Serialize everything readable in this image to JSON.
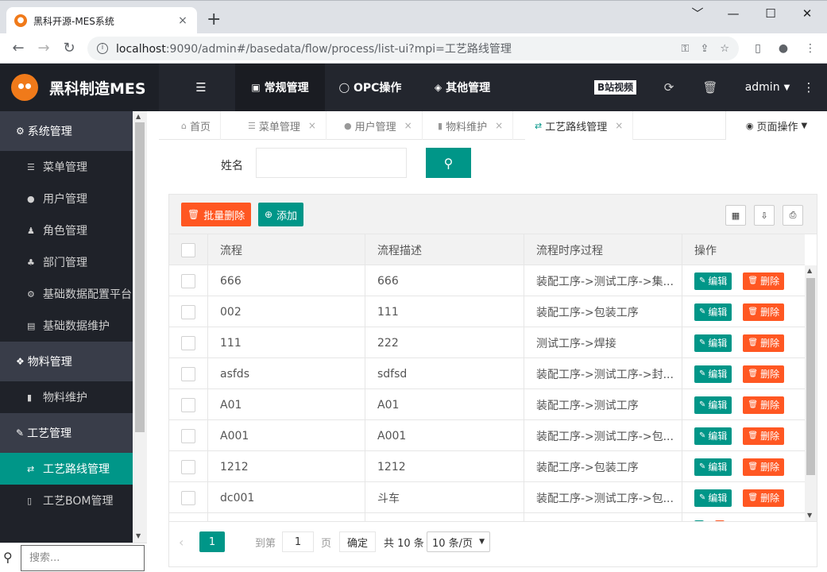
{
  "browser": {
    "tab_title": "黑科开源-MES系统",
    "tab_close": "×",
    "new_tab": "+",
    "url_host": "localhost",
    "url_rest": ":9090/admin#/basedata/flow/process/list-ui?mpi=工艺路线管理"
  },
  "app": {
    "logo_text": "黑科制造MES",
    "menu_toggle": "☰",
    "nav": [
      {
        "label": "常规管理",
        "icon": "▣"
      },
      {
        "label": "OPC操作",
        "icon": "◯"
      },
      {
        "label": "其他管理",
        "icon": "◈"
      }
    ],
    "bilibili": "B站视频",
    "user": "admin"
  },
  "sidebar": {
    "groups": [
      {
        "label": "系统管理",
        "icon": "⚙",
        "items": [
          {
            "label": "菜单管理",
            "icon": "☰"
          },
          {
            "label": "用户管理",
            "icon": "●"
          },
          {
            "label": "角色管理",
            "icon": "♟"
          },
          {
            "label": "部门管理",
            "icon": "♣"
          },
          {
            "label": "基础数据配置平台",
            "icon": "⚙"
          },
          {
            "label": "基础数据维护",
            "icon": "▤"
          }
        ]
      },
      {
        "label": "物料管理",
        "icon": "❖",
        "items": [
          {
            "label": "物料维护",
            "icon": "▮"
          }
        ]
      },
      {
        "label": "工艺管理",
        "icon": "✎",
        "items": [
          {
            "label": "工艺路线管理",
            "icon": "⇄"
          },
          {
            "label": "工艺BOM管理",
            "icon": "▯"
          }
        ]
      }
    ],
    "search_placeholder": "搜索..."
  },
  "page_tabs": [
    {
      "label": "首页",
      "icon": "⌂",
      "close": ""
    },
    {
      "label": "菜单管理",
      "icon": "☰",
      "close": "×"
    },
    {
      "label": "用户管理",
      "icon": "●",
      "close": "×"
    },
    {
      "label": "物料维护",
      "icon": "▮",
      "close": "×"
    },
    {
      "label": "工艺路线管理",
      "icon": "⇄",
      "close": "×"
    }
  ],
  "page_ops": "页面操作",
  "filter": {
    "label": "姓名",
    "value": "",
    "search_icon": "search-icon"
  },
  "toolbar": {
    "batch_delete": "批量删除",
    "add": "添加"
  },
  "table": {
    "headers": [
      "流程",
      "流程描述",
      "流程时序过程",
      "操作"
    ],
    "edit_label": "编辑",
    "delete_label": "删除",
    "rows": [
      {
        "flow": "666",
        "desc": "666",
        "process": "装配工序->测试工序->集..."
      },
      {
        "flow": "002",
        "desc": "111",
        "process": "装配工序->包装工序"
      },
      {
        "flow": "111",
        "desc": "222",
        "process": "测试工序->焊接"
      },
      {
        "flow": "asfds",
        "desc": "sdfsd",
        "process": "装配工序->测试工序->封..."
      },
      {
        "flow": "A01",
        "desc": "A01",
        "process": "装配工序->测试工序"
      },
      {
        "flow": "A001",
        "desc": "A001",
        "process": "装配工序->测试工序->包..."
      },
      {
        "flow": "1212",
        "desc": "1212",
        "process": "装配工序->包装工序"
      },
      {
        "flow": "dc001",
        "desc": "斗车",
        "process": "装配工序->测试工序->包..."
      }
    ]
  },
  "pager": {
    "prev": "‹",
    "current": "1",
    "goto_label": "到第",
    "goto_value": "1",
    "page_unit": "页",
    "ok": "确定",
    "total": "共 10 条",
    "page_size": "10 条/页"
  }
}
